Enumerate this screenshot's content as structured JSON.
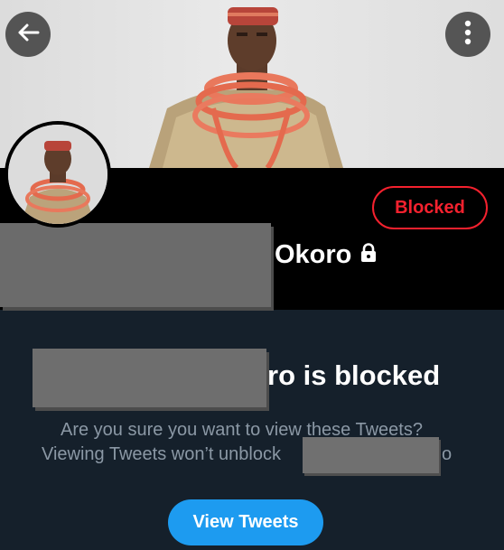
{
  "header": {
    "back_icon": "arrow-left-icon",
    "more_icon": "vertical-dots-icon"
  },
  "profile": {
    "blocked_label": "Blocked",
    "name_visible": "Okoro",
    "lock_icon": "lock-icon"
  },
  "blocked_notice": {
    "heading_visible": "ro is blocked",
    "line1": "Are you sure you want to view these Tweets?",
    "line2_visible": "Viewing Tweets won’t unblock",
    "line2_end": "o",
    "button_label": "View Tweets"
  },
  "colors": {
    "background": "#15202b",
    "strip": "#000000",
    "blocked_red": "#f4212e",
    "accent_blue": "#1d9bf0",
    "muted_text": "#8b98a5"
  }
}
